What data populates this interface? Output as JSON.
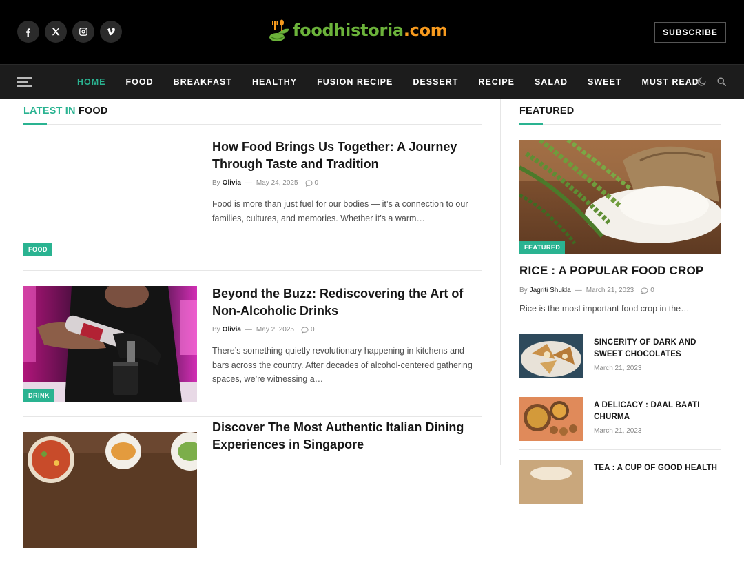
{
  "header": {
    "social": [
      {
        "name": "facebook-icon"
      },
      {
        "name": "x-icon"
      },
      {
        "name": "instagram-icon"
      },
      {
        "name": "vimeo-icon"
      }
    ],
    "logo": {
      "part1": "foodhistoria",
      "part2": ".com"
    },
    "subscribe_label": "SUBSCRIBE"
  },
  "nav": {
    "items": [
      "HOME",
      "FOOD",
      "BREAKFAST",
      "HEALTHY",
      "FUSION RECIPE",
      "DESSERT",
      "RECIPE",
      "SALAD",
      "SWEET",
      "MUST READ"
    ],
    "active": "HOME"
  },
  "main": {
    "section_title_accent": "LATEST IN",
    "section_title_rest": "FOOD",
    "posts": [
      {
        "title": "How Food Brings Us Together: A Journey Through Taste and Tradition",
        "by": "By",
        "author": "Olivia",
        "date": "May 24, 2025",
        "comments": "0",
        "excerpt": "Food is more than just fuel for our bodies — it’s a connection to our families, cultures, and memories. Whether it’s a warm…",
        "category": "FOOD"
      },
      {
        "title": "Beyond the Buzz: Rediscovering the Art of Non-Alcoholic Drinks",
        "by": "By",
        "author": "Olivia",
        "date": "May 2, 2025",
        "comments": "0",
        "excerpt": "There’s something quietly revolutionary happening in kitchens and bars across the country. After decades of alcohol-centered gathering spaces, we’re witnessing a…",
        "category": "DRINK"
      },
      {
        "title": "Discover The Most Authentic Italian Dining Experiences in Singapore",
        "by": "",
        "author": "",
        "date": "",
        "comments": "",
        "excerpt": "",
        "category": ""
      }
    ]
  },
  "sidebar": {
    "title": "FEATURED",
    "featured": {
      "category": "FEATURED",
      "title": "RICE : A POPULAR FOOD CROP",
      "by": "By",
      "author": "Jagriti Shukla",
      "date": "March 21, 2023",
      "comments": "0",
      "excerpt": "Rice is the most important food crop in the…"
    },
    "items": [
      {
        "title": "SINCERITY OF DARK AND SWEET CHOCOLATES",
        "date": "March 21, 2023"
      },
      {
        "title": "A DELICACY : DAAL BAATI CHURMA",
        "date": "March 21, 2023"
      },
      {
        "title": "TEA : A CUP OF GOOD HEALTH",
        "date": ""
      }
    ]
  },
  "colors": {
    "accent": "#2ab391",
    "logo_green": "#6bb23a",
    "logo_orange": "#f79a1e",
    "header_bg": "#000000",
    "nav_bg": "#1c1c1c"
  }
}
